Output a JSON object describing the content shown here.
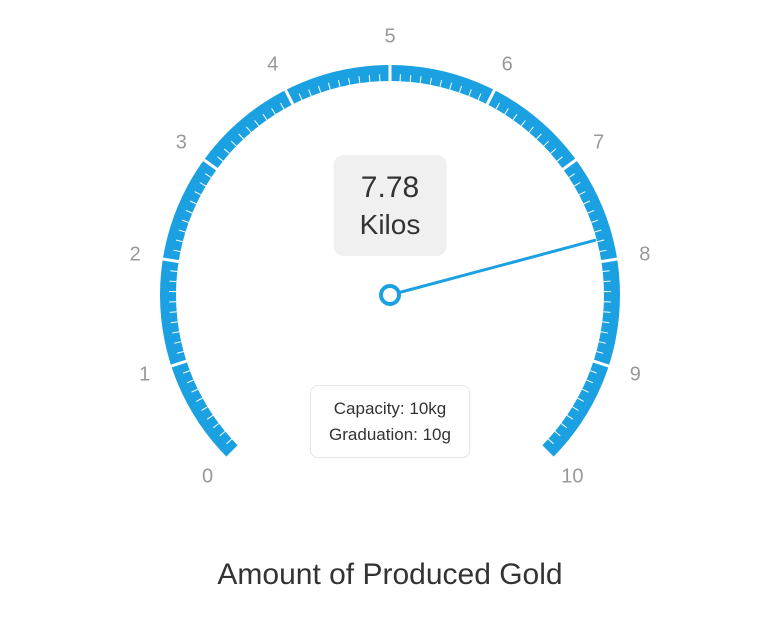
{
  "chart_data": {
    "type": "gauge",
    "title": "Amount of Produced Gold",
    "value": 7.78,
    "value_display": "7.78",
    "unit_label": "Kilos",
    "min": 0,
    "max": 10,
    "start_angle_deg": -225,
    "end_angle_deg": 45,
    "major_ticks": [
      0,
      1,
      2,
      3,
      4,
      5,
      6,
      7,
      8,
      9,
      10
    ],
    "minor_ticks_per_major": 10,
    "arc_color": "#1ba1e2",
    "needle_color": "#1ba1e2",
    "tick_label_color": "#999999",
    "info_lines": [
      "Capacity: 10kg",
      "Graduation: 10g"
    ]
  },
  "gauge": {
    "value_text": "7.78",
    "unit_text": "Kilos",
    "info_line1": "Capacity: 10kg",
    "info_line2": "Graduation: 10g",
    "title_text": "Amount of Produced Gold"
  }
}
